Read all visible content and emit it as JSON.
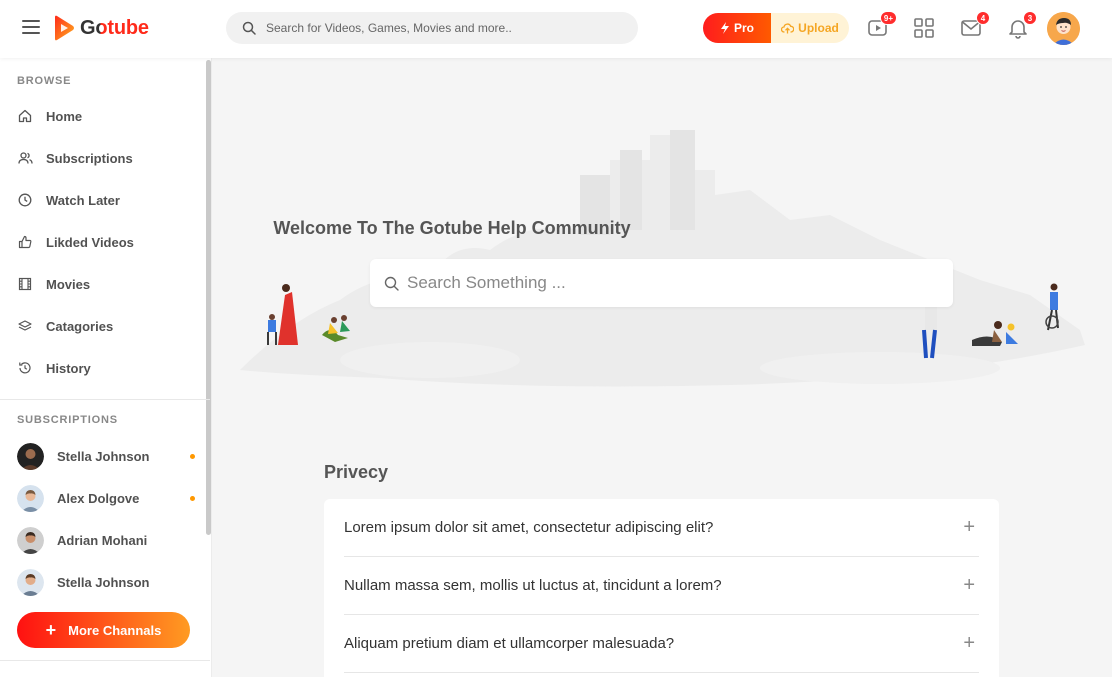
{
  "header": {
    "brand": "Gotube",
    "search_placeholder": "Search for Videos, Games, Movies and more..",
    "pro_label": "Pro",
    "upload_label": "Upload",
    "video_badge": "9+",
    "mail_badge": "4",
    "bell_badge": "3"
  },
  "sidebar": {
    "browse_title": "BROWSE",
    "items": [
      {
        "label": "Home",
        "icon": "home-icon"
      },
      {
        "label": "Subscriptions",
        "icon": "users-icon"
      },
      {
        "label": "Watch Later",
        "icon": "clock-icon"
      },
      {
        "label": "Likded Videos",
        "icon": "thumbs-up-icon"
      },
      {
        "label": "Movies",
        "icon": "film-icon"
      },
      {
        "label": "Catagories",
        "icon": "layers-icon"
      },
      {
        "label": "History",
        "icon": "history-icon"
      }
    ],
    "subscriptions_title": "SUBSCRIPTIONS",
    "subscriptions": [
      {
        "name": "Stella Johnson",
        "new": true
      },
      {
        "name": "Alex Dolgove",
        "new": true
      },
      {
        "name": "Adrian Mohani",
        "new": false
      },
      {
        "name": "Stella Johnson",
        "new": false
      }
    ],
    "more_label": "More Channals"
  },
  "hero": {
    "title": "Welcome To The Gotube Help Community",
    "search_placeholder": "Search Something ..."
  },
  "faq": {
    "title": "Privecy",
    "questions": [
      "Lorem ipsum dolor sit amet, consectetur adipiscing elit?",
      "Nullam massa sem, mollis ut luctus at, tincidunt a lorem?",
      "Aliquam pretium diam et ullamcorper malesuada?"
    ]
  },
  "colors": {
    "brand_red": "#ff1d1d",
    "brand_orange": "#ff9b22",
    "upload_bg": "#fff3d6",
    "badge_red": "#ff2d2d"
  }
}
